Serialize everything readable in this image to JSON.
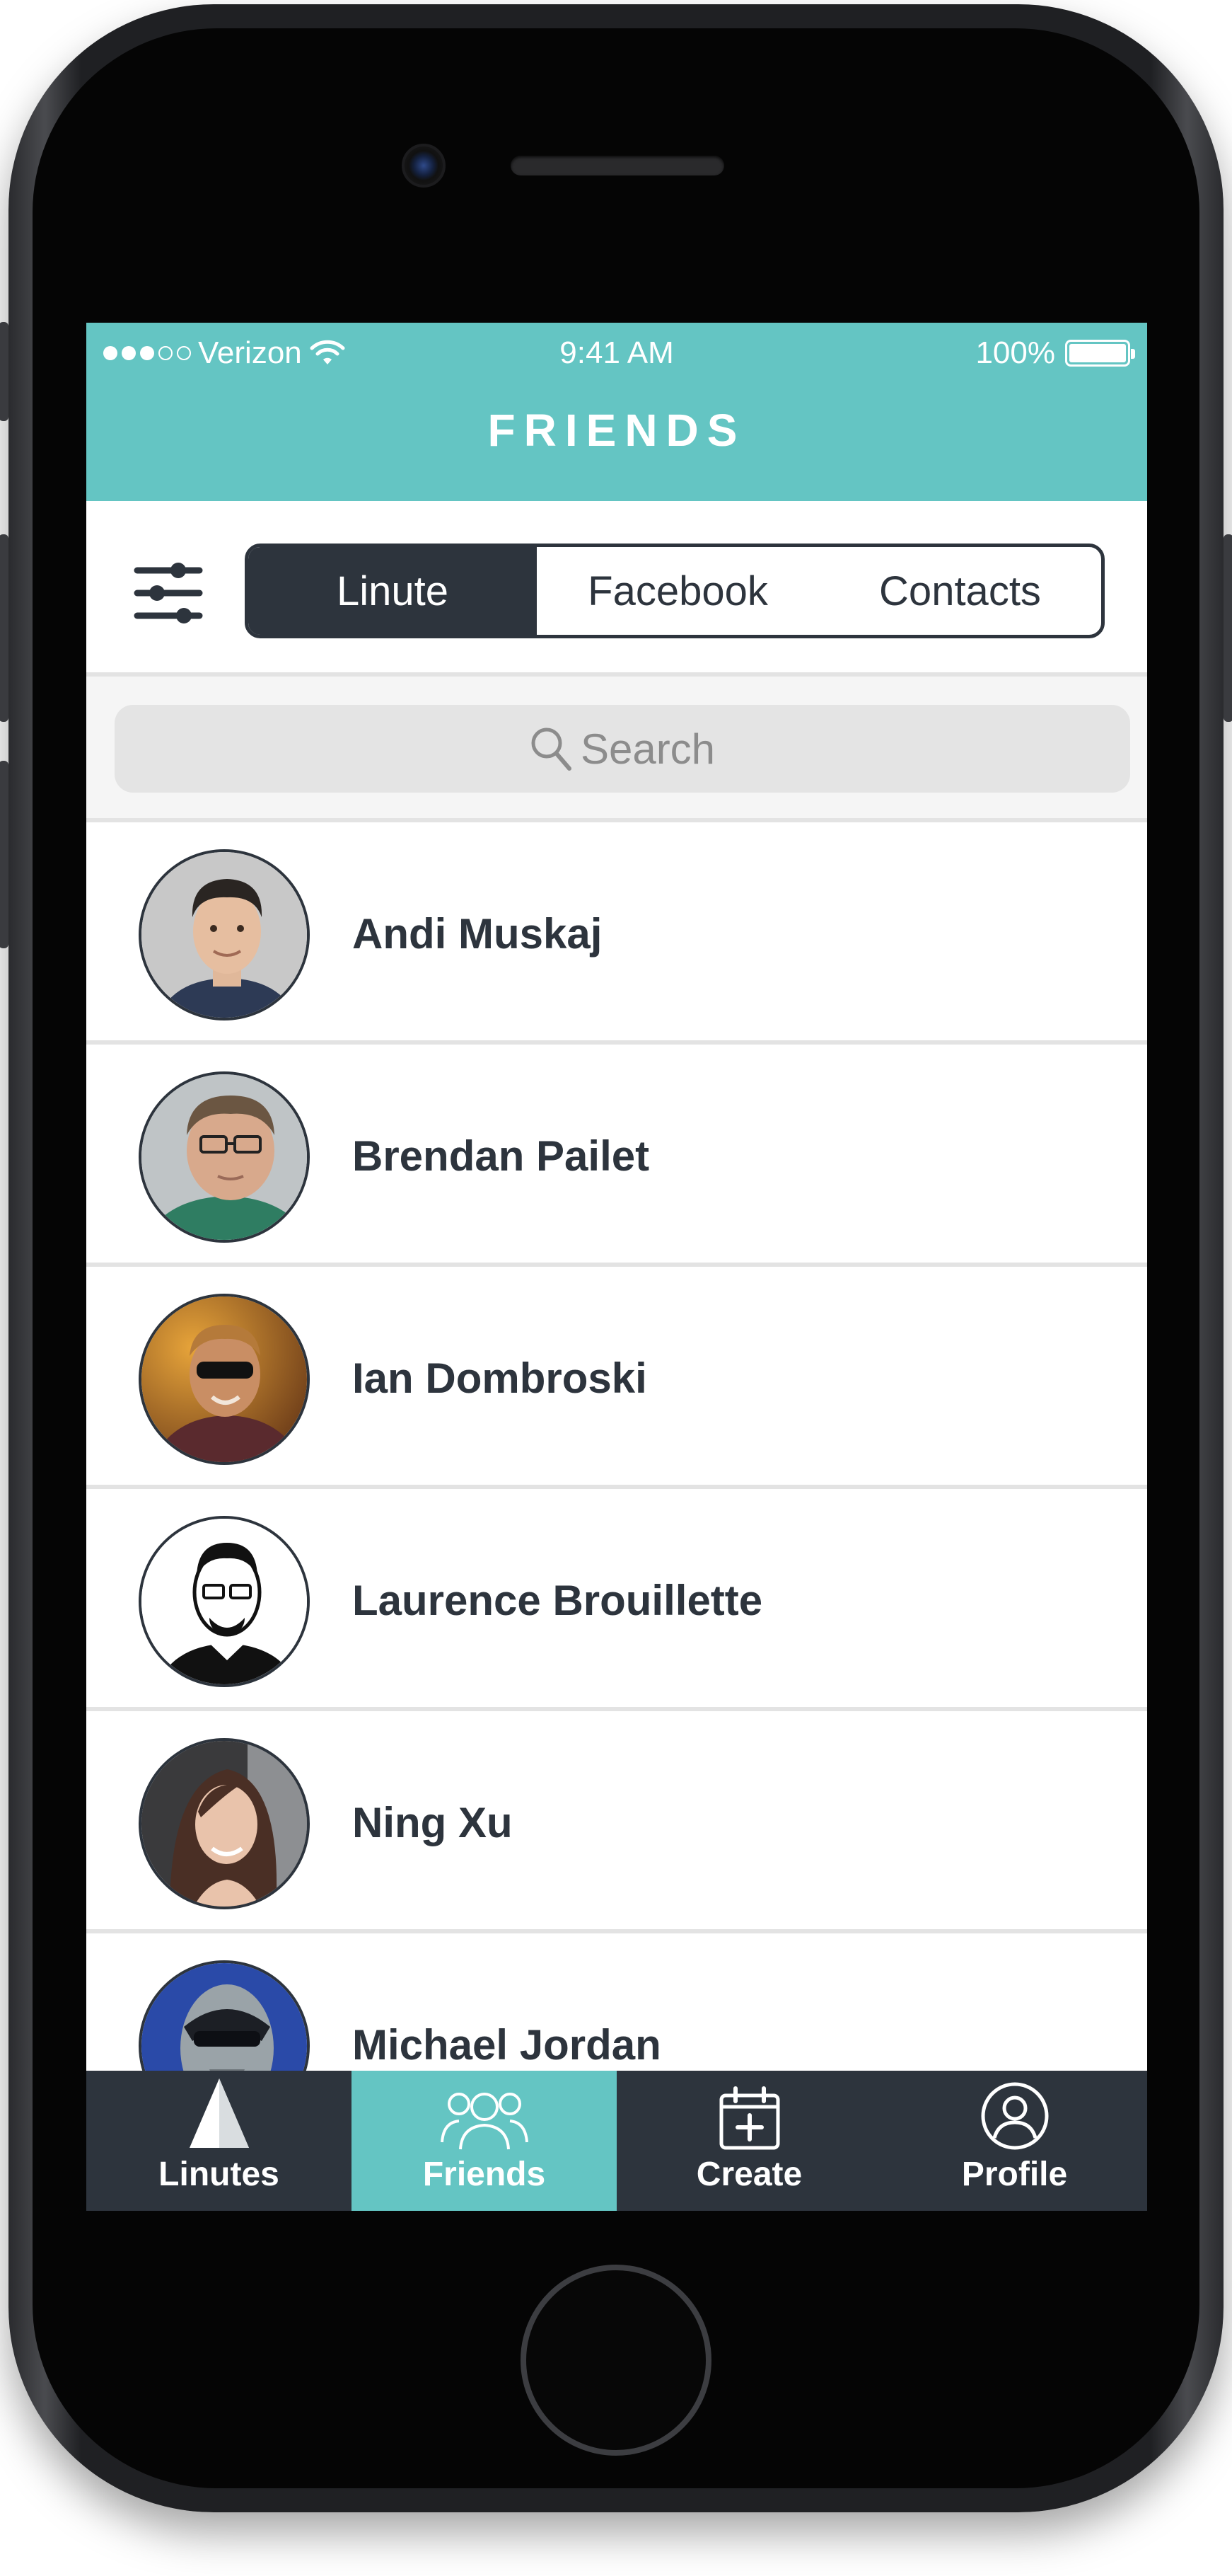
{
  "status_bar": {
    "carrier": "Verizon",
    "time": "9:41 AM",
    "battery": "100%"
  },
  "header": {
    "title": "FRIENDS"
  },
  "segments": [
    {
      "label": "Linute",
      "active": true
    },
    {
      "label": "Facebook",
      "active": false
    },
    {
      "label": "Contacts",
      "active": false
    }
  ],
  "search": {
    "placeholder": "Search"
  },
  "friends": [
    {
      "name": "Andi Muskaj"
    },
    {
      "name": "Brendan Pailet"
    },
    {
      "name": "Ian Dombroski"
    },
    {
      "name": "Laurence Brouillette"
    },
    {
      "name": "Ning Xu"
    },
    {
      "name": "Michael Jordan"
    }
  ],
  "tabs": [
    {
      "label": "Linutes",
      "icon": "linutes-pyramid-icon",
      "active": false
    },
    {
      "label": "Friends",
      "icon": "friends-icon",
      "active": true
    },
    {
      "label": "Create",
      "icon": "calendar-add-icon",
      "active": false
    },
    {
      "label": "Profile",
      "icon": "profile-icon",
      "active": false
    }
  ],
  "colors": {
    "accent": "#64c5c3",
    "dark": "#2d343d",
    "divider": "#e3e3e3"
  }
}
